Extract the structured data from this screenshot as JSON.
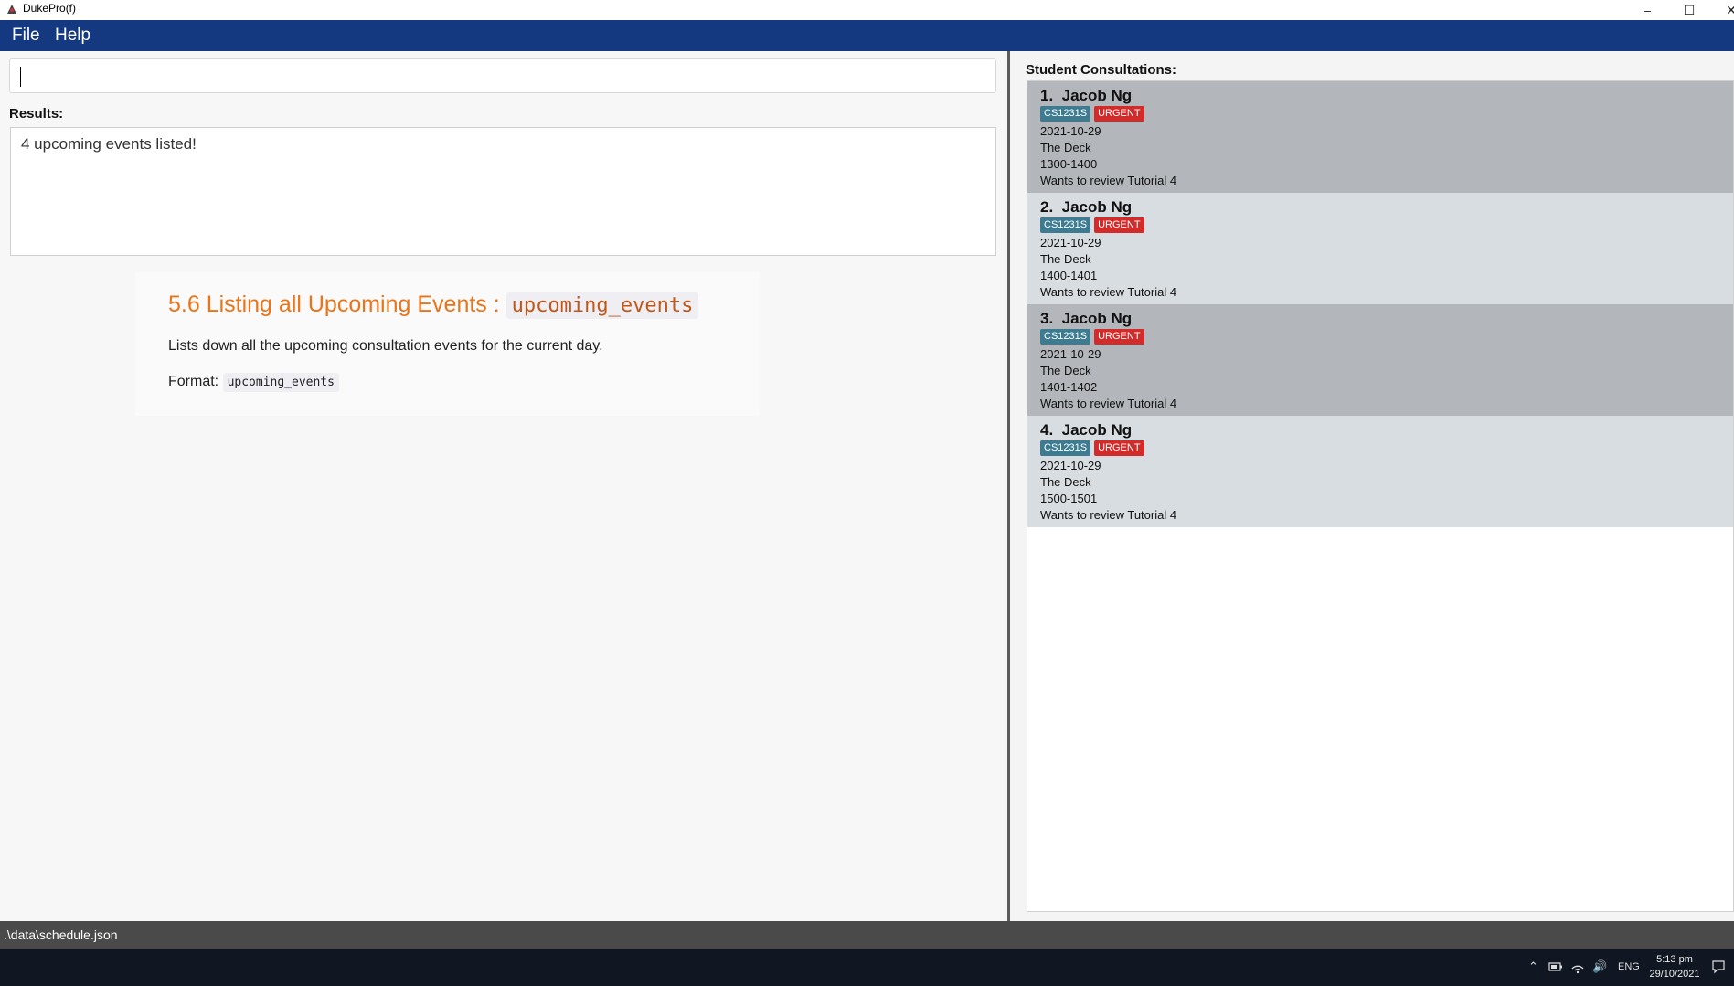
{
  "window": {
    "title": "DukePro(f)"
  },
  "menu": {
    "items": [
      "File",
      "Help"
    ]
  },
  "command": {
    "value": ""
  },
  "results": {
    "label": "Results:",
    "text": "4 upcoming events listed!"
  },
  "help": {
    "title": "5.6 Listing all Upcoming Events : ",
    "title_code": "upcoming_events",
    "description": "Lists down all the upcoming consultation events for the current day.",
    "format_label": "Format: ",
    "format_code": "upcoming_events"
  },
  "consultations": {
    "label": "Student Consultations:",
    "items": [
      {
        "name": "1.  Jacob Ng",
        "module": "CS1231S",
        "urgent": "URGENT",
        "date": "2021-10-29",
        "venue": "The Deck",
        "time": "1300-1400",
        "remark": "Wants to review Tutorial 4"
      },
      {
        "name": "2.  Jacob Ng",
        "module": "CS1231S",
        "urgent": "URGENT",
        "date": "2021-10-29",
        "venue": "The Deck",
        "time": "1400-1401",
        "remark": "Wants to review Tutorial 4"
      },
      {
        "name": "3.  Jacob Ng",
        "module": "CS1231S",
        "urgent": "URGENT",
        "date": "2021-10-29",
        "venue": "The Deck",
        "time": "1401-1402",
        "remark": "Wants to review Tutorial 4"
      },
      {
        "name": "4.  Jacob Ng",
        "module": "CS1231S",
        "urgent": "URGENT",
        "date": "2021-10-29",
        "venue": "The Deck",
        "time": "1500-1501",
        "remark": "Wants to review Tutorial 4"
      }
    ]
  },
  "status": {
    "path": ".\\data\\schedule.json"
  },
  "taskbar": {
    "language": "ENG",
    "time": "5:13 pm",
    "date": "29/10/2021"
  },
  "colors": {
    "menubar": "#143980",
    "accent_title": "#e8751a",
    "tag_module": "#3e7b91",
    "tag_urgent": "#d32a2a"
  }
}
